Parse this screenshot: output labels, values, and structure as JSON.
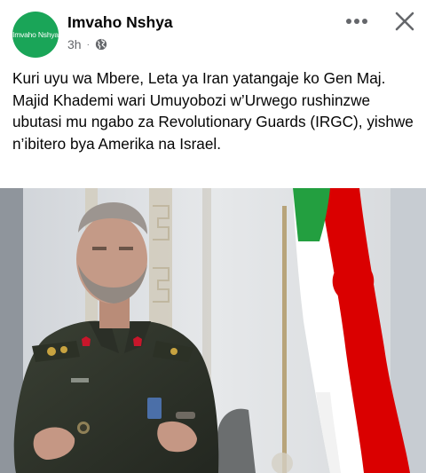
{
  "post": {
    "page_name": "Imvaho Nshya",
    "avatar_text": "Imvaho Nshya",
    "time": "3h",
    "separator": "·",
    "audience_icon": "globe-icon",
    "caption": "Kuri uyu wa Mbere, Leta ya Iran yatangaje ko Gen Maj. Majid Khademi wari Umuyobozi w’Urwego rushinzwe ubutasi mu ngabo za Revolutionary Guards (IRGC), yishwe n’ibitero bya Amerika na Israel."
  },
  "actions": {
    "more_icon": "more-horizontal-icon",
    "close_icon": "close-icon"
  },
  "colors": {
    "brand_green": "#1aa558",
    "meta_gray": "#65676b",
    "text": "#050505",
    "flag_green": "#239f40",
    "flag_red": "#da0000"
  }
}
